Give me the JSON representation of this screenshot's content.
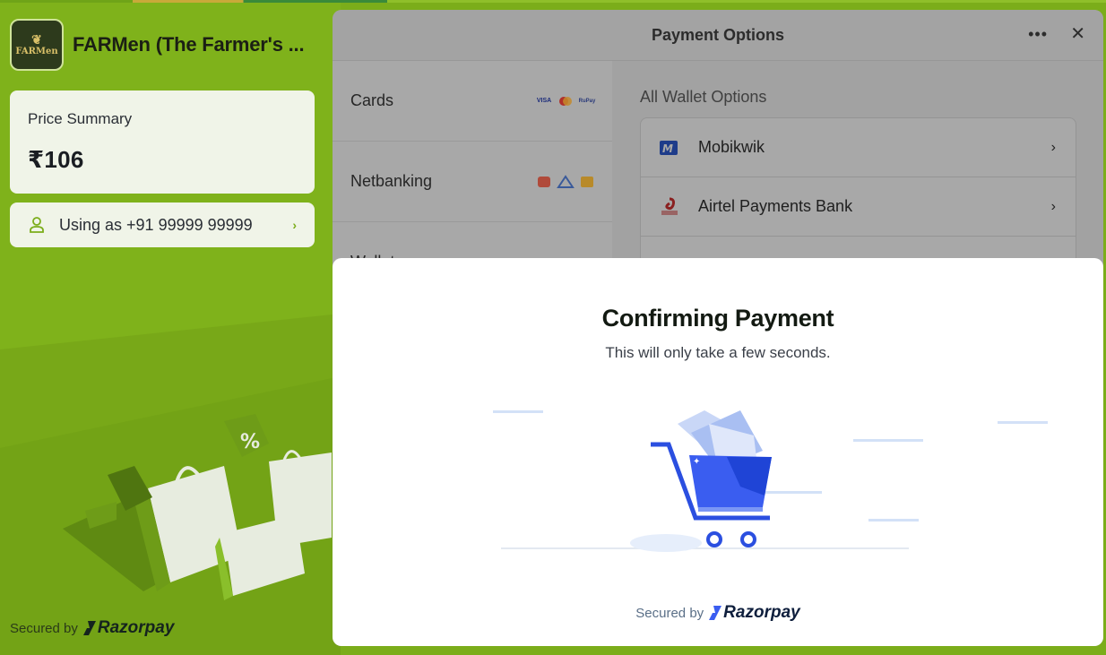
{
  "merchant": {
    "name": "FARMen (The Farmer's ...",
    "logo_text": "FARMen"
  },
  "summary": {
    "label": "Price Summary",
    "amount": "₹106"
  },
  "user": {
    "text": "Using as +91 99999 99999"
  },
  "footer_left": {
    "secured_by": "Secured by",
    "brand": "Razorpay"
  },
  "panel": {
    "title": "Payment Options",
    "more_icon": "more-horizontal-icon",
    "close_icon": "close-icon",
    "methods": [
      {
        "label": "Cards"
      },
      {
        "label": "Netbanking"
      },
      {
        "label": "Wallet"
      }
    ],
    "card_icons": {
      "visa": "VISA",
      "rupay": "RuPay"
    },
    "wallets": {
      "heading": "All Wallet Options",
      "items": [
        {
          "name": "Mobikwik"
        },
        {
          "name": "Airtel Payments Bank"
        }
      ]
    }
  },
  "confirm": {
    "title": "Confirming Payment",
    "subtitle": "This will only take a few seconds.",
    "secured_by": "Secured by",
    "brand": "Razorpay"
  },
  "colors": {
    "background_green": "#7bad1a",
    "brand_blue": "#3a5df0",
    "dim_panel": "#a2a2a2"
  }
}
